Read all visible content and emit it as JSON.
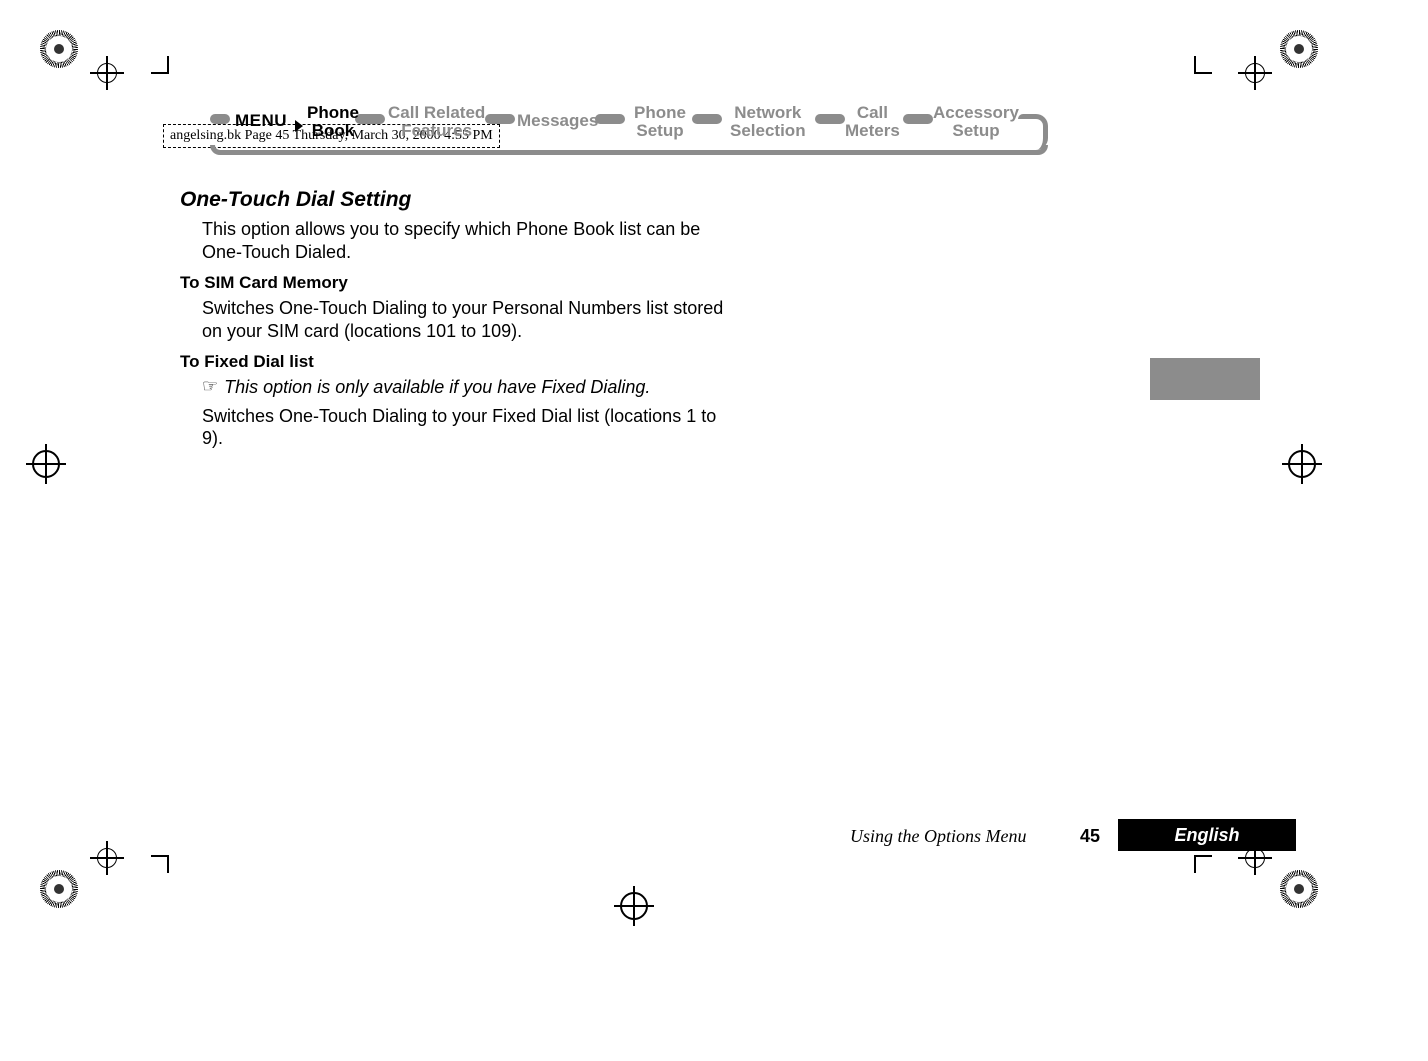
{
  "header": "angelsing.bk  Page 45  Thursday, March 30, 2000  4:55 PM",
  "menu": {
    "label": "MENU",
    "items": [
      {
        "line1": "Phone",
        "line2": "Book",
        "active": true
      },
      {
        "line1": "Call Related",
        "line2": "Features",
        "active": false
      },
      {
        "line1": "Messages",
        "line2": "",
        "active": false
      },
      {
        "line1": "Phone",
        "line2": "Setup",
        "active": false
      },
      {
        "line1": "Network",
        "line2": "Selection",
        "active": false
      },
      {
        "line1": "Call",
        "line2": "Meters",
        "active": false
      },
      {
        "line1": "Accessory",
        "line2": "Setup",
        "active": false
      }
    ]
  },
  "section": {
    "title": "One-Touch Dial Setting",
    "intro": "This option allows you to specify which Phone Book list can be One-Touch Dialed.",
    "sub1_title": "To SIM Card Memory",
    "sub1_body": "Switches One-Touch Dialing to your Personal Numbers list stored on your SIM card (locations 101 to 109).",
    "sub2_title": "To Fixed Dial list",
    "sub2_note": "This option is only available if you have Fixed Dialing.",
    "sub2_body": "Switches One-Touch Dialing to your Fixed Dial list (locations 1 to 9)."
  },
  "footer": {
    "chapter": "Using the Options Menu",
    "page": "45",
    "language": "English"
  },
  "note_icon": "☞"
}
